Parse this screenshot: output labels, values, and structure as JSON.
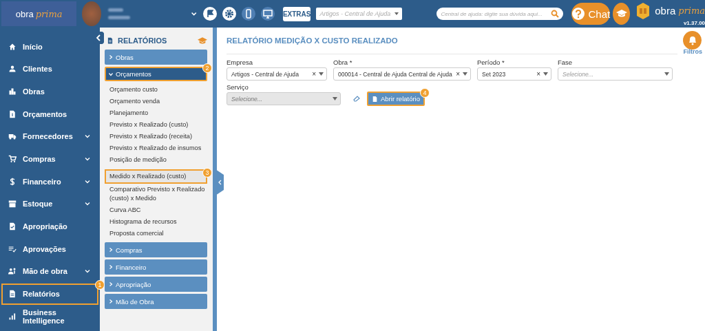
{
  "header": {
    "logo": {
      "word": "obra",
      "script": "prima"
    },
    "toolbar_icons": [
      {
        "kind": "flag",
        "filled": true
      },
      {
        "kind": "gear",
        "filled": true
      },
      {
        "kind": "phone",
        "filled": false
      },
      {
        "kind": "monitor",
        "filled": false
      }
    ],
    "extras_button": "EXTRAS",
    "project_select": {
      "placeholder": "Artigos - Central de Ajuda"
    },
    "search": {
      "placeholder": "Central de ajuda: digite sua dúvida aqui..."
    },
    "chat_button": "Chat",
    "brand": {
      "word": "obra",
      "script": "prima"
    },
    "version": "v1.37.00"
  },
  "sidebar": {
    "items": [
      {
        "label": "Início",
        "kind": "home",
        "expandable": false,
        "highlighted": false
      },
      {
        "label": "Clientes",
        "kind": "user",
        "expandable": false,
        "highlighted": false
      },
      {
        "label": "Obras",
        "kind": "building",
        "expandable": false,
        "highlighted": false
      },
      {
        "label": "Orçamentos",
        "kind": "money-doc",
        "expandable": false,
        "highlighted": false
      },
      {
        "label": "Fornecedores",
        "kind": "truck",
        "expandable": true,
        "highlighted": false
      },
      {
        "label": "Compras",
        "kind": "cart",
        "expandable": true,
        "highlighted": false
      },
      {
        "label": "Financeiro",
        "kind": "dollar",
        "expandable": true,
        "highlighted": false
      },
      {
        "label": "Estoque",
        "kind": "box",
        "expandable": true,
        "highlighted": false
      },
      {
        "label": "Apropriação",
        "kind": "check-doc",
        "expandable": false,
        "highlighted": false
      },
      {
        "label": "Aprovações",
        "kind": "list-check",
        "expandable": false,
        "highlighted": false
      },
      {
        "label": "Mão de obra",
        "kind": "workers",
        "expandable": true,
        "highlighted": false
      },
      {
        "label": "Relatórios",
        "kind": "doc",
        "expandable": false,
        "highlighted": true,
        "marker": "1"
      },
      {
        "label": "Business Intelligence",
        "kind": "bars",
        "expandable": false,
        "highlighted": false
      }
    ]
  },
  "reports_panel": {
    "title": "RELATÓRIOS",
    "groups": [
      {
        "label": "Obras",
        "expanded": false,
        "highlighted": false
      },
      {
        "label": "Orçamentos",
        "expanded": true,
        "highlighted": true,
        "marker": "2",
        "children": [
          {
            "label": "Orçamento custo",
            "highlighted": false
          },
          {
            "label": "Orçamento venda",
            "highlighted": false
          },
          {
            "label": "Planejamento",
            "highlighted": false
          },
          {
            "label": "Previsto x Realizado (custo)",
            "highlighted": false
          },
          {
            "label": "Previsto x Realizado (receita)",
            "highlighted": false
          },
          {
            "label": "Previsto x Realizado de insumos",
            "highlighted": false
          },
          {
            "label": "Posição de medição",
            "highlighted": false
          },
          {
            "label": "Medido x Realizado (custo)",
            "highlighted": true,
            "marker": "3"
          },
          {
            "label": "Comparativo Previsto x Realizado (custo) x Medido",
            "highlighted": false
          },
          {
            "label": "Curva ABC",
            "highlighted": false
          },
          {
            "label": "Histograma de recursos",
            "highlighted": false
          },
          {
            "label": "Proposta comercial",
            "highlighted": false
          }
        ]
      },
      {
        "label": "Compras",
        "expanded": false,
        "highlighted": false
      },
      {
        "label": "Financeiro",
        "expanded": false,
        "highlighted": false
      },
      {
        "label": "Apropriação",
        "expanded": false,
        "highlighted": false
      },
      {
        "label": "Mão de Obra",
        "expanded": false,
        "highlighted": false
      }
    ]
  },
  "main": {
    "title": "RELATÓRIO MEDIÇÃO X CUSTO REALIZADO",
    "filters_label": "Filtros",
    "fields": [
      {
        "label": "Empresa",
        "value": "Artigos - Central de Ajuda",
        "clear": "×",
        "disabled": false
      },
      {
        "label": "Obra *",
        "value": "000014 - Central de Ajuda Central de Ajuda",
        "clear": "×",
        "disabled": false
      },
      {
        "label": "Período *",
        "value": "Set 2023",
        "clear": "×",
        "disabled": false
      },
      {
        "label": "Fase",
        "placeholder": "Selecione...",
        "disabled": false
      },
      {
        "label": "Serviço",
        "placeholder": "Selecione...",
        "disabled": true
      }
    ],
    "open_button": {
      "label": "Abrir relatório",
      "highlighted": true,
      "marker": "4"
    }
  }
}
